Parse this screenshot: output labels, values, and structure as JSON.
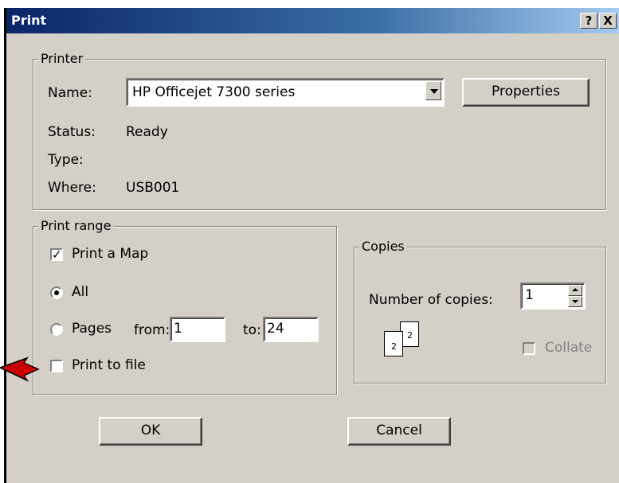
{
  "window": {
    "title": "Print",
    "help_btn": "?",
    "close_btn": "X"
  },
  "printer": {
    "group_label": "Printer",
    "name_label": "Name:",
    "name_value": "HP Officejet 7300 series",
    "properties_btn": "Properties",
    "status_label": "Status:",
    "status_value": "Ready",
    "type_label": "Type:",
    "type_value": "",
    "where_label": "Where:",
    "where_value": "USB001"
  },
  "print_range": {
    "group_label": "Print range",
    "print_map_label": "Print a Map",
    "print_map_checked": true,
    "all_label": "All",
    "pages_label": "Pages",
    "from_label": "from:",
    "from_value": "1",
    "to_label": "to:",
    "to_value": "24",
    "selected": "All"
  },
  "print_to_file": {
    "label": "Print to file",
    "checked": false
  },
  "copies": {
    "group_label": "Copies",
    "number_label": "Number of copies:",
    "number_value": "1",
    "collate_label": "Collate",
    "collate_enabled": false,
    "page_icon_labels": [
      "2",
      "2"
    ]
  },
  "buttons": {
    "ok": "OK",
    "cancel": "Cancel"
  },
  "colors": {
    "titlebar_start": "#0a246a",
    "dialog_bg": "#d4d0c8",
    "arrow": "#cc0000"
  }
}
